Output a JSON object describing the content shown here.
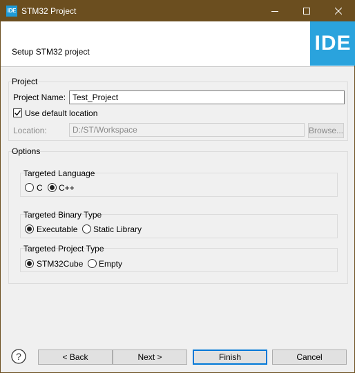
{
  "window": {
    "app_icon_text": "IDE",
    "title": "STM32 Project",
    "controls": {
      "minimize": "minimize-icon",
      "maximize": "maximize-icon",
      "close": "close-icon"
    }
  },
  "banner": {
    "title": "Setup STM32 project",
    "logo_text": "IDE",
    "logo_color": "#2aa3dd"
  },
  "project": {
    "group_label": "Project",
    "name_label": "Project Name:",
    "name_value": "Test_Project",
    "use_default_location_label": "Use default location",
    "use_default_location_checked": true,
    "location_label": "Location:",
    "location_value": "D:/ST/Workspace",
    "browse_label": "Browse..."
  },
  "options": {
    "group_label": "Options",
    "language": {
      "label": "Targeted Language",
      "choices": [
        "C",
        "C++"
      ],
      "selected": "C++"
    },
    "binary_type": {
      "label": "Targeted Binary Type",
      "choices": [
        "Executable",
        "Static Library"
      ],
      "selected": "Executable"
    },
    "project_type": {
      "label": "Targeted Project Type",
      "choices": [
        "STM32Cube",
        "Empty"
      ],
      "selected": "STM32Cube"
    }
  },
  "footer": {
    "help_icon": "help-icon",
    "back_label": "< Back",
    "next_label": "Next >",
    "finish_label": "Finish",
    "cancel_label": "Cancel"
  }
}
